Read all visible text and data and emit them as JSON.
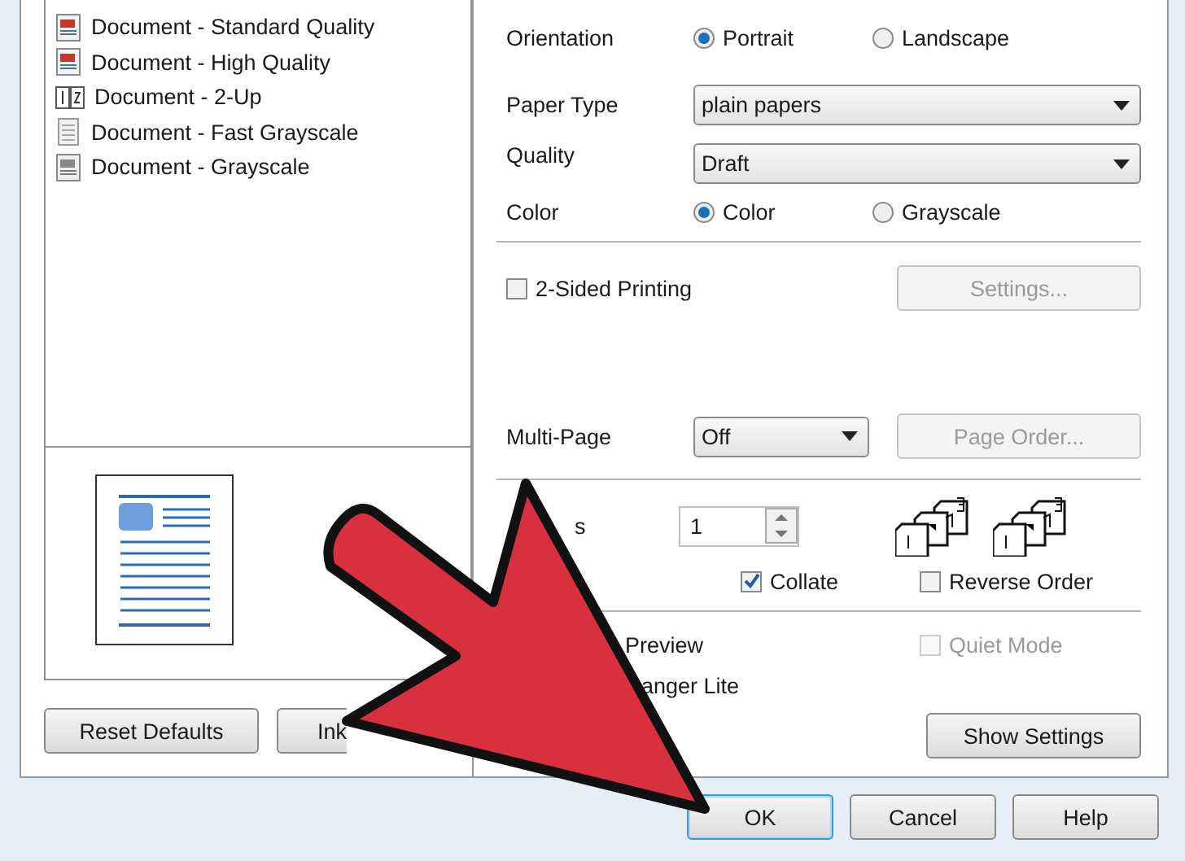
{
  "presets": [
    {
      "label": "Document - Standard Quality",
      "kind": "color"
    },
    {
      "label": "Document - High Quality",
      "kind": "color"
    },
    {
      "label": "Document - 2-Up",
      "kind": "two-up"
    },
    {
      "label": "Document - Fast Grayscale",
      "kind": "plain"
    },
    {
      "label": "Document - Grayscale",
      "kind": "gray"
    }
  ],
  "orientation": {
    "label": "Orientation",
    "options": [
      {
        "label": "Portrait",
        "selected": true
      },
      {
        "label": "Landscape",
        "selected": false
      }
    ]
  },
  "paper_type": {
    "label": "Paper Type",
    "value": "plain papers"
  },
  "quality": {
    "label": "Quality",
    "value": "Draft"
  },
  "color": {
    "label": "Color",
    "options": [
      {
        "label": "Color",
        "selected": true
      },
      {
        "label": "Grayscale",
        "selected": false
      }
    ]
  },
  "two_sided": {
    "label": "2-Sided Printing",
    "checked": false
  },
  "settings_button": {
    "label": "Settings...",
    "disabled": true
  },
  "multi_page": {
    "label": "Multi-Page",
    "value": "Off"
  },
  "page_order_button": {
    "label": "Page Order...",
    "disabled": true
  },
  "copies": {
    "label": "s",
    "value": "1"
  },
  "collate": {
    "label": "Collate",
    "checked": true
  },
  "reverse_order": {
    "label": "Reverse Order",
    "checked": false
  },
  "preview": {
    "label": "Preview"
  },
  "quiet_mode": {
    "label": "Quiet Mode",
    "checked": false,
    "disabled": true
  },
  "manager": {
    "label": "anger Lite"
  },
  "show_settings_button": {
    "label": "Show Settings"
  },
  "left_buttons": [
    {
      "label": "Reset Defaults"
    },
    {
      "label": "Ink"
    }
  ],
  "dialog_buttons": [
    {
      "label": "OK",
      "default": true
    },
    {
      "label": "Cancel",
      "default": false
    },
    {
      "label": "Help",
      "default": false
    }
  ]
}
